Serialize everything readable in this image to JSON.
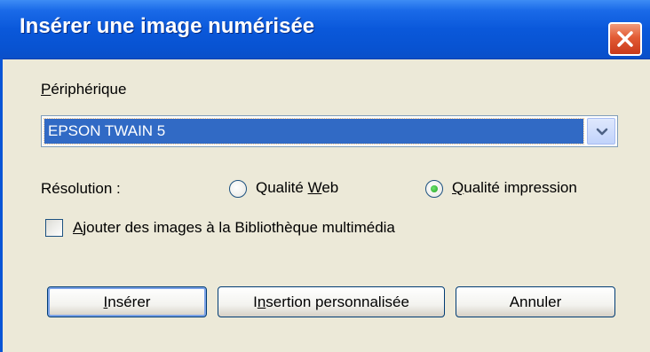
{
  "window": {
    "title": "Insérer une image numérisée"
  },
  "device": {
    "label_mnemonic": "P",
    "label_rest": "ériphérique",
    "selected_value": "EPSON TWAIN 5"
  },
  "resolution": {
    "label": "Résolution :",
    "options": [
      {
        "label_before": "Qualité ",
        "mnemonic": "W",
        "label_after": "eb",
        "selected": false
      },
      {
        "label_before": "",
        "mnemonic": "Q",
        "label_after": "ualité impression",
        "selected": true
      }
    ]
  },
  "add_to_library": {
    "mnemonic": "A",
    "label_rest": "jouter des images à la Bibliothèque multimédia",
    "checked": false
  },
  "buttons": {
    "insert_mnemonic": "I",
    "insert_rest": "nsérer",
    "custom_before": "I",
    "custom_mnemonic": "n",
    "custom_rest": "sertion personnalisée",
    "cancel": "Annuler"
  }
}
